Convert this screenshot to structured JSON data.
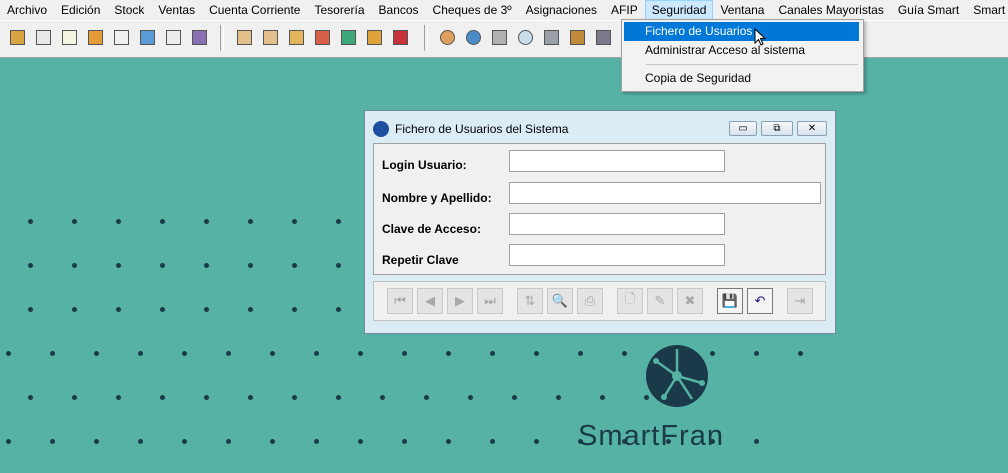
{
  "menubar": {
    "items": [
      "Archivo",
      "Edición",
      "Stock",
      "Ventas",
      "Cuenta Corriente",
      "Tesorería",
      "Bancos",
      "Cheques de 3º",
      "Asignaciones",
      "AFIP",
      "Seguridad",
      "Ventana",
      "Canales Mayoristas",
      "Guía Smart",
      "Smart Coach"
    ],
    "active_index": 10
  },
  "dropdown": {
    "items": [
      "Fichero de Usuarios",
      "Administrar Acceso al sistema",
      "Copia de Seguridad"
    ],
    "highlighted_index": 0
  },
  "dialog": {
    "title": "Fichero de Usuarios del Sistema",
    "fields": {
      "login": {
        "label": "Login Usuario:",
        "value": ""
      },
      "nombre": {
        "label": "Nombre y Apellido:",
        "value": ""
      },
      "clave": {
        "label": "Clave de Acceso:",
        "value": ""
      },
      "repetir": {
        "label": "Repetir Clave",
        "value": ""
      }
    },
    "window_buttons": {
      "minimize": "▭",
      "maximize": "⧉",
      "close": "✕"
    }
  },
  "nav_glyphs": {
    "first": "⏮",
    "prev": "◀",
    "next": "▶",
    "last": "⏭",
    "sort": "⇅",
    "search": "🔍",
    "print": "⎙",
    "new": "🗋",
    "edit": "✎",
    "delete": "✖",
    "save": "💾",
    "undo": "↶",
    "exit": "⇥"
  },
  "logo": {
    "text": "SmartFran"
  },
  "colors": {
    "background": "#55b2a5",
    "highlight": "#0078d7",
    "logo": "#1a3a49"
  }
}
